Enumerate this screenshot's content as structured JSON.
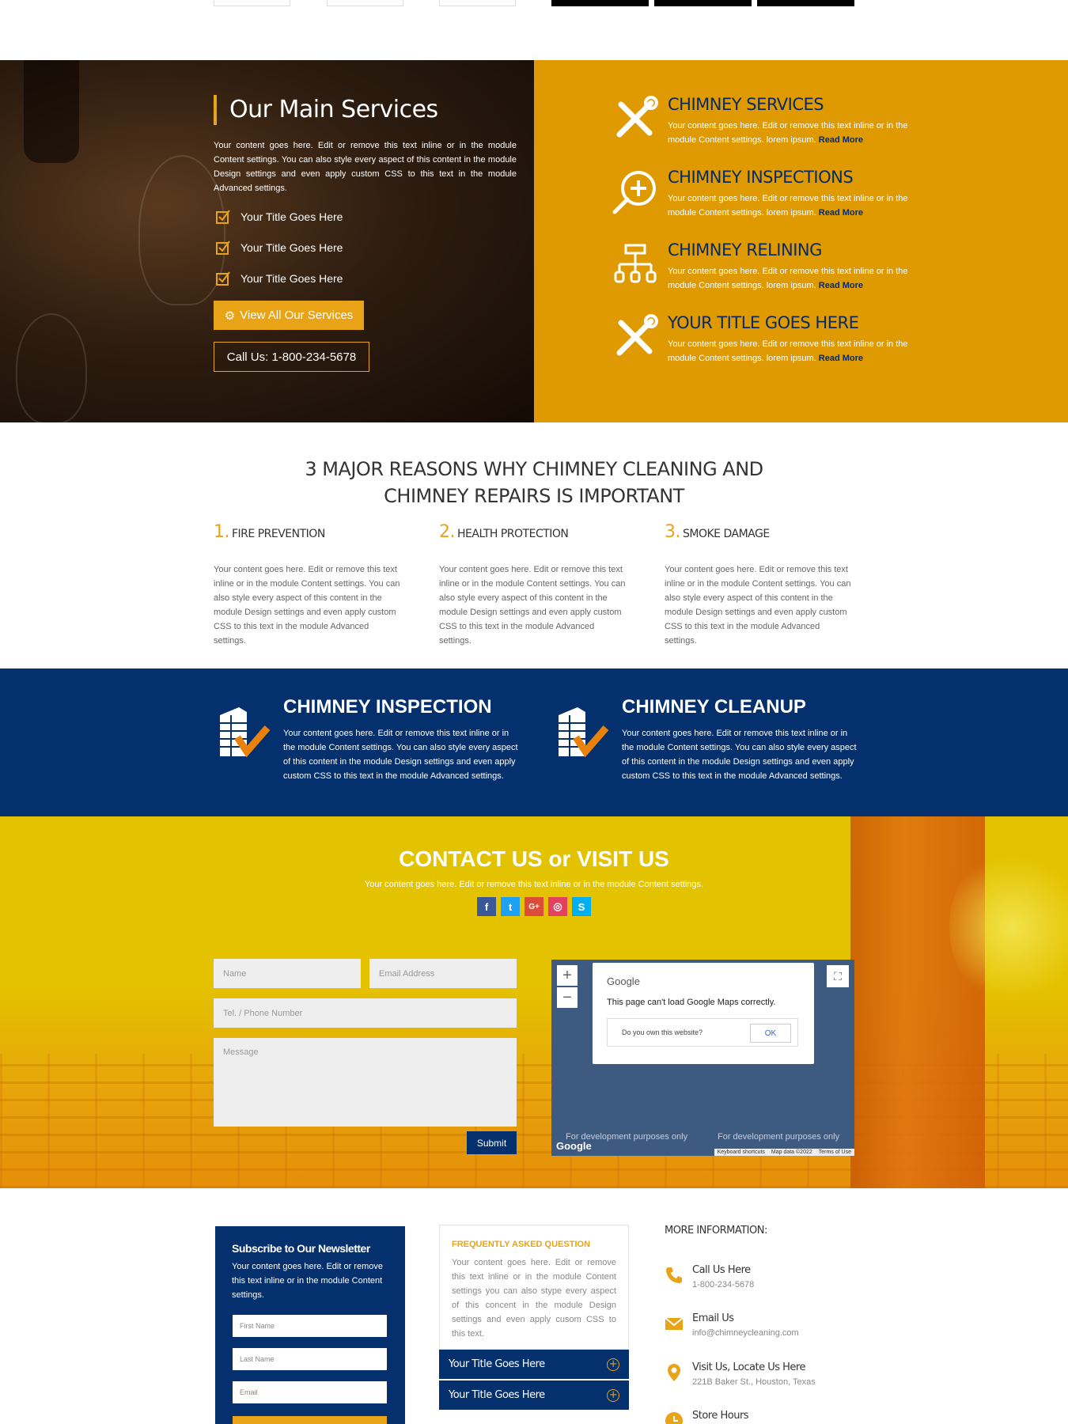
{
  "services": {
    "title": "Our Main Services",
    "text": "Your content goes here. Edit or remove this text inline or in the module Content settings. You can also style every aspect of this content in the module Design settings and even apply custom CSS to this text in the module Advanced settings.",
    "checks": [
      "Your Title Goes Here",
      "Your Title Goes Here",
      "Your Title Goes Here"
    ],
    "view_all_label": "View All Our Services",
    "call_label": "Call Us: 1-800-234-5678",
    "items": [
      {
        "title": "CHIMNEY SERVICES",
        "text": "Your content goes here. Edit or remove this text inline or in the module Content settings. lorem ipsum.",
        "link": "Read More",
        "icon": "tools-icon"
      },
      {
        "title": "CHIMNEY INSPECTIONS",
        "text": "Your content goes here. Edit or remove this text inline or in the module Content settings. lorem ipsum.",
        "link": "Read More",
        "icon": "magnifier-plus-icon"
      },
      {
        "title": "CHIMNEY RELINING",
        "text": "Your content goes here. Edit or remove this text inline or in the module Content settings. lorem ipsum.",
        "link": "Read More",
        "icon": "sitemap-icon"
      },
      {
        "title": "YOUR TITLE GOES HERE",
        "text": "Your content goes here. Edit or remove this text inline or in the module Content settings. lorem ipsum.",
        "link": "Read More",
        "icon": "tools-icon"
      }
    ]
  },
  "reasons": {
    "heading_line1": "3 MAJOR REASONS WHY CHIMNEY CLEANING AND",
    "heading_line2": "CHIMNEY REPAIRS IS IMPORTANT",
    "items": [
      {
        "num": "1.",
        "title": "FIRE PREVENTION",
        "text": "Your content goes here. Edit or remove this text inline or in the module Content settings. You can also style every aspect of this content in the module Design settings and even apply custom CSS to this text in the module Advanced settings."
      },
      {
        "num": "2.",
        "title": "HEALTH PROTECTION",
        "text": "Your content goes here. Edit or remove this text inline or in the module Content settings. You can also style every aspect of this content in the module Design settings and even apply custom CSS to this text in the module Advanced settings."
      },
      {
        "num": "3.",
        "title": "SMOKE DAMAGE",
        "text": "Your content goes here. Edit or remove this text inline or in the module Content settings. You can also style every aspect of this content in the module Design settings and even apply custom CSS to this text in the module Advanced settings."
      }
    ]
  },
  "features": [
    {
      "title": "CHIMNEY INSPECTION",
      "text": "Your content goes here. Edit or remove this text inline or in the module Content settings. You can also style every aspect of this content in the module Design settings and even apply custom CSS to this text in the module Advanced settings."
    },
    {
      "title": "CHIMNEY CLEANUP",
      "text": "Your content goes here. Edit or remove this text inline or in the module Content settings. You can also style every aspect of this content in the module Design settings and even apply custom CSS to this text in the module Advanced settings."
    }
  ],
  "contact": {
    "title": "CONTACT US or VISIT US",
    "subtitle": "Your content goes here. Edit or remove this text inline or in the module Content settings.",
    "social": [
      {
        "icon": "facebook-icon",
        "glyph": "f",
        "color": "#3b5998"
      },
      {
        "icon": "twitter-icon",
        "glyph": "t",
        "color": "#1da1f2"
      },
      {
        "icon": "google-plus-icon",
        "glyph": "G+",
        "color": "#dd4b39"
      },
      {
        "icon": "instagram-icon",
        "glyph": "◎",
        "color": "#e4405f"
      },
      {
        "icon": "skype-icon",
        "glyph": "S",
        "color": "#00aff0"
      }
    ],
    "form": {
      "name_placeholder": "Name",
      "email_placeholder": "Email Address",
      "phone_placeholder": "Tel. / Phone Number",
      "message_placeholder": "Message",
      "submit_label": "Submit"
    },
    "map": {
      "zoom_in": "+",
      "zoom_out": "−",
      "google_label": "Google",
      "error_text": "This page can't load Google Maps correctly.",
      "own_text": "Do you own this website?",
      "ok_label": "OK",
      "dev_text": "For development purposes only",
      "shortcuts": "Keyboard shortcuts",
      "map_data": "Map data ©2022",
      "terms": "Terms of Use"
    }
  },
  "footer": {
    "newsletter": {
      "title": "Subscribe to Our Newsletter",
      "text": "Your content goes here. Edit or remove this text inline or in the module Content settings.",
      "first_name": "First Name",
      "last_name": "Last Name",
      "email": "Email"
    },
    "faq": {
      "title": "FREQUENTLY ASKED QUESTION",
      "text": "Your content goes here. Edit or remove this text inline or in the module Content settings you can also stype every aspect of this concent in the module Design settings and even apply cusom CSS to this text.",
      "items": [
        "Your Title Goes Here",
        "Your Title Goes Here"
      ]
    },
    "more": {
      "heading": "MORE INFORMATION:",
      "items": [
        {
          "icon": "phone-icon",
          "title": "Call Us Here",
          "value": "1-800-234-5678"
        },
        {
          "icon": "envelope-icon",
          "title": "Email Us",
          "value": "info@chimneycleaning.com"
        },
        {
          "icon": "map-pin-icon",
          "title": "Visit Us, Locate Us Here",
          "value": "221B Baker St., Houston, Texas"
        },
        {
          "icon": "clock-icon",
          "title": "Store Hours",
          "value": ""
        }
      ]
    }
  },
  "colors": {
    "accent": "#e8a317",
    "navy": "#04306d",
    "gold": "#de9a00"
  }
}
